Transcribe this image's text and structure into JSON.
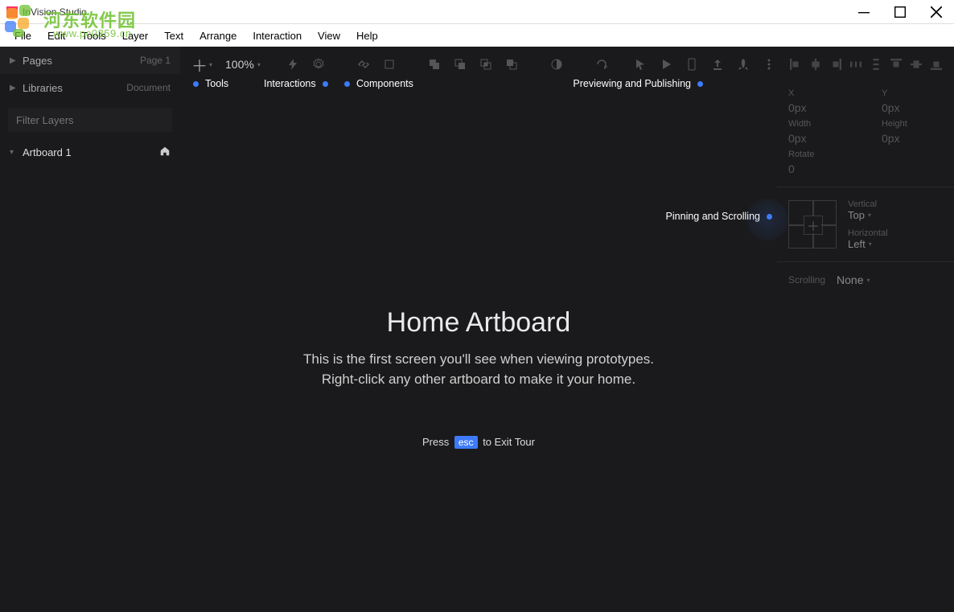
{
  "window": {
    "title": "InVision Studio"
  },
  "watermark": {
    "text": "河东软件园",
    "url": "www.pc0359.cn"
  },
  "menubar": [
    "File",
    "Edit",
    "Tools",
    "Layer",
    "Text",
    "Arrange",
    "Interaction",
    "View",
    "Help"
  ],
  "toolbar": {
    "zoom": "100%"
  },
  "left_sidebar": {
    "pages": {
      "label": "Pages",
      "meta": "Page 1"
    },
    "libraries": {
      "label": "Libraries",
      "meta": "Document"
    },
    "filter_placeholder": "Filter Layers",
    "artboard": "Artboard 1"
  },
  "tour": {
    "tools": "Tools",
    "interactions": "Interactions",
    "components": "Components",
    "previewing": "Previewing and Publishing",
    "pinning": "Pinning and Scrolling"
  },
  "home": {
    "title": "Home Artboard",
    "body": "This is the first screen you'll see when viewing prototypes. Right-click any other artboard to make it your home.",
    "exit_prefix": "Press",
    "exit_key": "esc",
    "exit_suffix": "to Exit Tour"
  },
  "right_sidebar": {
    "x_label": "X",
    "x_value": "0px",
    "y_label": "Y",
    "y_value": "0px",
    "width_label": "Width",
    "width_value": "0px",
    "height_label": "Height",
    "height_value": "0px",
    "rotate_label": "Rotate",
    "rotate_value": "0",
    "vertical_label": "Vertical",
    "vertical_value": "Top",
    "horizontal_label": "Horizontal",
    "horizontal_value": "Left",
    "scrolling_label": "Scrolling",
    "scrolling_value": "None"
  }
}
